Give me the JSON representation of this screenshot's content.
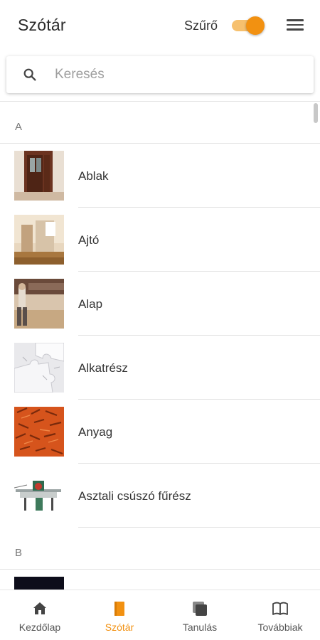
{
  "header": {
    "title": "Szótár",
    "filter_label": "Szűrő",
    "filter_enabled": true
  },
  "search": {
    "placeholder": "Keresés",
    "value": ""
  },
  "sections": [
    {
      "letter": "A",
      "items": [
        {
          "label": "Ablak"
        },
        {
          "label": "Ajtó"
        },
        {
          "label": "Alap"
        },
        {
          "label": "Alkatrész"
        },
        {
          "label": "Anyag"
        },
        {
          "label": "Asztali csúszó fűrész"
        }
      ]
    },
    {
      "letter": "B",
      "items": [
        {
          "label": ""
        }
      ]
    }
  ],
  "bottom_nav": [
    {
      "label": "Kezdőlap",
      "icon": "home-icon",
      "active": false
    },
    {
      "label": "Szótár",
      "icon": "dictionary-icon",
      "active": true
    },
    {
      "label": "Tanulás",
      "icon": "learning-icon",
      "active": false
    },
    {
      "label": "Továbbiak",
      "icon": "book-icon",
      "active": false
    }
  ],
  "colors": {
    "accent": "#f29111",
    "accent_light": "#f6c06e",
    "text": "#333333",
    "divider": "#e3e3e3"
  }
}
